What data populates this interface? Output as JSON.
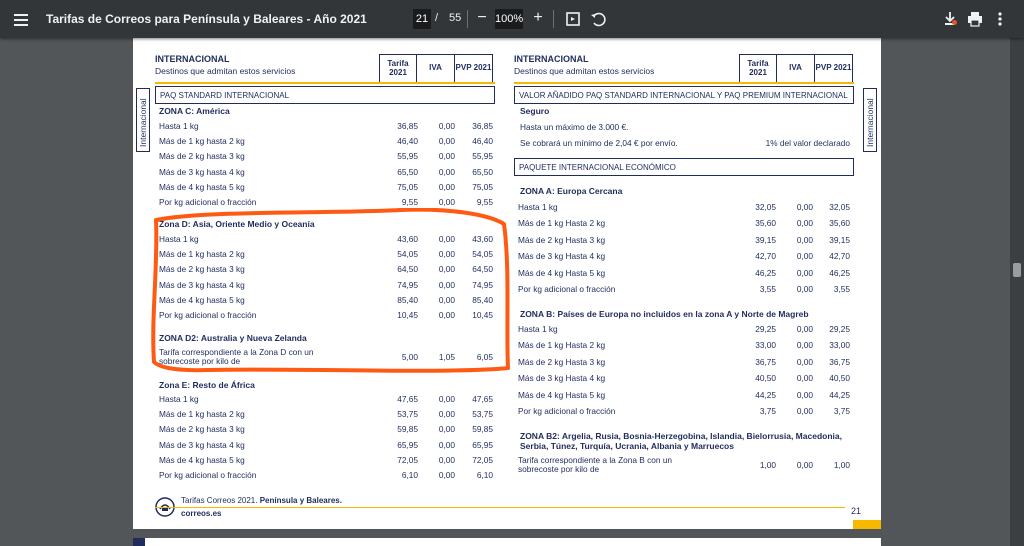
{
  "toolbar": {
    "title": "Tarifas de Correos para Península y Baleares - Año 2021",
    "current_page": "21",
    "page_separator": "/",
    "total_pages": "55",
    "zoom": "100%",
    "zoom_out": "−",
    "zoom_in": "+"
  },
  "left": {
    "header_title": "INTERNACIONAL",
    "header_sub": "Destinos que admitan estos servicios",
    "col_tarifa": "Tarifa 2021",
    "col_iva": "IVA",
    "col_pvp": "PVP 2021",
    "section": "PAQ STANDARD INTERNACIONAL",
    "side_tab": "Internacional",
    "zone_c": {
      "title": "ZONA C: América",
      "rows": [
        {
          "label": "Hasta 1 kg",
          "tarifa": "36,85",
          "iva": "0,00",
          "pvp": "36,85"
        },
        {
          "label": "Más de 1 kg hasta 2 kg",
          "tarifa": "46,40",
          "iva": "0,00",
          "pvp": "46,40"
        },
        {
          "label": "Más de 2 kg hasta 3 kg",
          "tarifa": "55,95",
          "iva": "0,00",
          "pvp": "55,95"
        },
        {
          "label": "Más de 3 kg hasta 4 kg",
          "tarifa": "65,50",
          "iva": "0,00",
          "pvp": "65,50"
        },
        {
          "label": "Más de 4 kg hasta 5 kg",
          "tarifa": "75,05",
          "iva": "0,00",
          "pvp": "75,05"
        },
        {
          "label": "Por kg adicional o fracción",
          "tarifa": "9,55",
          "iva": "0,00",
          "pvp": "9,55"
        }
      ]
    },
    "zone_d": {
      "title": "Zona D: Asia, Oriente Medio y Oceanía",
      "rows": [
        {
          "label": "Hasta 1 kg",
          "tarifa": "43,60",
          "iva": "0,00",
          "pvp": "43,60"
        },
        {
          "label": "Más de 1 kg hasta 2 kg",
          "tarifa": "54,05",
          "iva": "0,00",
          "pvp": "54,05"
        },
        {
          "label": "Más de 2 kg hasta 3 kg",
          "tarifa": "64,50",
          "iva": "0,00",
          "pvp": "64,50"
        },
        {
          "label": "Más de 3 kg hasta 4 kg",
          "tarifa": "74,95",
          "iva": "0,00",
          "pvp": "74,95"
        },
        {
          "label": "Más de 4 kg hasta 5 kg",
          "tarifa": "85,40",
          "iva": "0,00",
          "pvp": "85,40"
        },
        {
          "label": "Por kg adicional o fracción",
          "tarifa": "10,45",
          "iva": "0,00",
          "pvp": "10,45"
        }
      ]
    },
    "zone_d2": {
      "title": "ZONA D2: Australia y Nueva Zelanda",
      "row": {
        "label": "Tarifa correspondiente a la Zona D con un sobrecoste por kilo de",
        "tarifa": "5,00",
        "iva": "1,05",
        "pvp": "6,05"
      }
    },
    "zone_e": {
      "title": "Zona E: Resto de África",
      "rows": [
        {
          "label": "Hasta 1 kg",
          "tarifa": "47,65",
          "iva": "0,00",
          "pvp": "47,65"
        },
        {
          "label": "Más de 1 kg hasta 2 kg",
          "tarifa": "53,75",
          "iva": "0,00",
          "pvp": "53,75"
        },
        {
          "label": "Más de 2 kg hasta 3 kg",
          "tarifa": "59,85",
          "iva": "0,00",
          "pvp": "59,85"
        },
        {
          "label": "Más de 3 kg hasta 4 kg",
          "tarifa": "65,95",
          "iva": "0,00",
          "pvp": "65,95"
        },
        {
          "label": "Más de 4 kg hasta 5 kg",
          "tarifa": "72,05",
          "iva": "0,00",
          "pvp": "72,05"
        },
        {
          "label": "Por kg adicional o fracción",
          "tarifa": "6,10",
          "iva": "0,00",
          "pvp": "6,10"
        }
      ]
    }
  },
  "right": {
    "header_title": "INTERNACIONAL",
    "header_sub": "Destinos que admitan estos servicios",
    "col_tarifa": "Tarifa 2021",
    "col_iva": "IVA",
    "col_pvp": "PVP 2021",
    "side_tab": "Internacional",
    "section_1": "VALOR AÑADIDO PAQ STANDARD INTERNACIONAL Y PAQ PREMIUM INTERNACIONAL",
    "seguro": {
      "title": "Seguro",
      "line1": "Hasta un máximo de 3.000 €.",
      "line2": "Se cobrará un mínimo de 2,04 € por envío.",
      "value": "1% del valor declarado"
    },
    "section_2": "PAQUETE INTERNACIONAL ECONÓMICO",
    "zone_a": {
      "title": "ZONA A: Europa Cercana",
      "rows": [
        {
          "label": "Hasta 1 kg",
          "tarifa": "32,05",
          "iva": "0,00",
          "pvp": "32,05"
        },
        {
          "label": "Más de 1 kg Hasta 2 kg",
          "tarifa": "35,60",
          "iva": "0,00",
          "pvp": "35,60"
        },
        {
          "label": "Más de 2 kg Hasta 3 kg",
          "tarifa": "39,15",
          "iva": "0,00",
          "pvp": "39,15"
        },
        {
          "label": "Más de 3 kg Hasta 4 kg",
          "tarifa": "42,70",
          "iva": "0,00",
          "pvp": "42,70"
        },
        {
          "label": "Más de 4 kg Hasta 5 kg",
          "tarifa": "46,25",
          "iva": "0,00",
          "pvp": "46,25"
        },
        {
          "label": "Por kg adicional o fracción",
          "tarifa": "3,55",
          "iva": "0,00",
          "pvp": "3,55"
        }
      ]
    },
    "zone_b": {
      "title": "ZONA B: Países de Europa no incluidos en la zona A y Norte de Magreb",
      "rows": [
        {
          "label": "Hasta 1 kg",
          "tarifa": "29,25",
          "iva": "0,00",
          "pvp": "29,25"
        },
        {
          "label": "Más de 1 kg Hasta 2 kg",
          "tarifa": "33,00",
          "iva": "0,00",
          "pvp": "33,00"
        },
        {
          "label": "Más de 2 kg Hasta 3 kg",
          "tarifa": "36,75",
          "iva": "0,00",
          "pvp": "36,75"
        },
        {
          "label": "Más de 3 kg Hasta 4 kg",
          "tarifa": "40,50",
          "iva": "0,00",
          "pvp": "40,50"
        },
        {
          "label": "Más de 4 kg Hasta 5 kg",
          "tarifa": "44,25",
          "iva": "0,00",
          "pvp": "44,25"
        },
        {
          "label": "Por kg adicional o fracción",
          "tarifa": "3,75",
          "iva": "0,00",
          "pvp": "3,75"
        }
      ]
    },
    "zone_b2": {
      "title_1": "ZONA B2: Argelia, Rusia, Bosnia-Herzegobina, Islandia, Bielorrusia, Macedonia,",
      "title_2": "Serbia, Túnez, Turquía, Ucrania, Albania y Marruecos",
      "row": {
        "label": "Tarifa correspondiente a la Zona B con un sobrecoste por kilo de",
        "tarifa": "1,00",
        "iva": "0,00",
        "pvp": "1,00"
      }
    }
  },
  "footer": {
    "text_prefix": "Tarifas Correos 2021. ",
    "text_bold": "Península y Baleares.",
    "url": "correos.es",
    "page_number": "21"
  },
  "colors": {
    "navy": "#1f2c5c",
    "yellow": "#f6b900",
    "annotation": "#ff5a14",
    "toolbar": "#323639",
    "viewer_bg": "#525659"
  }
}
